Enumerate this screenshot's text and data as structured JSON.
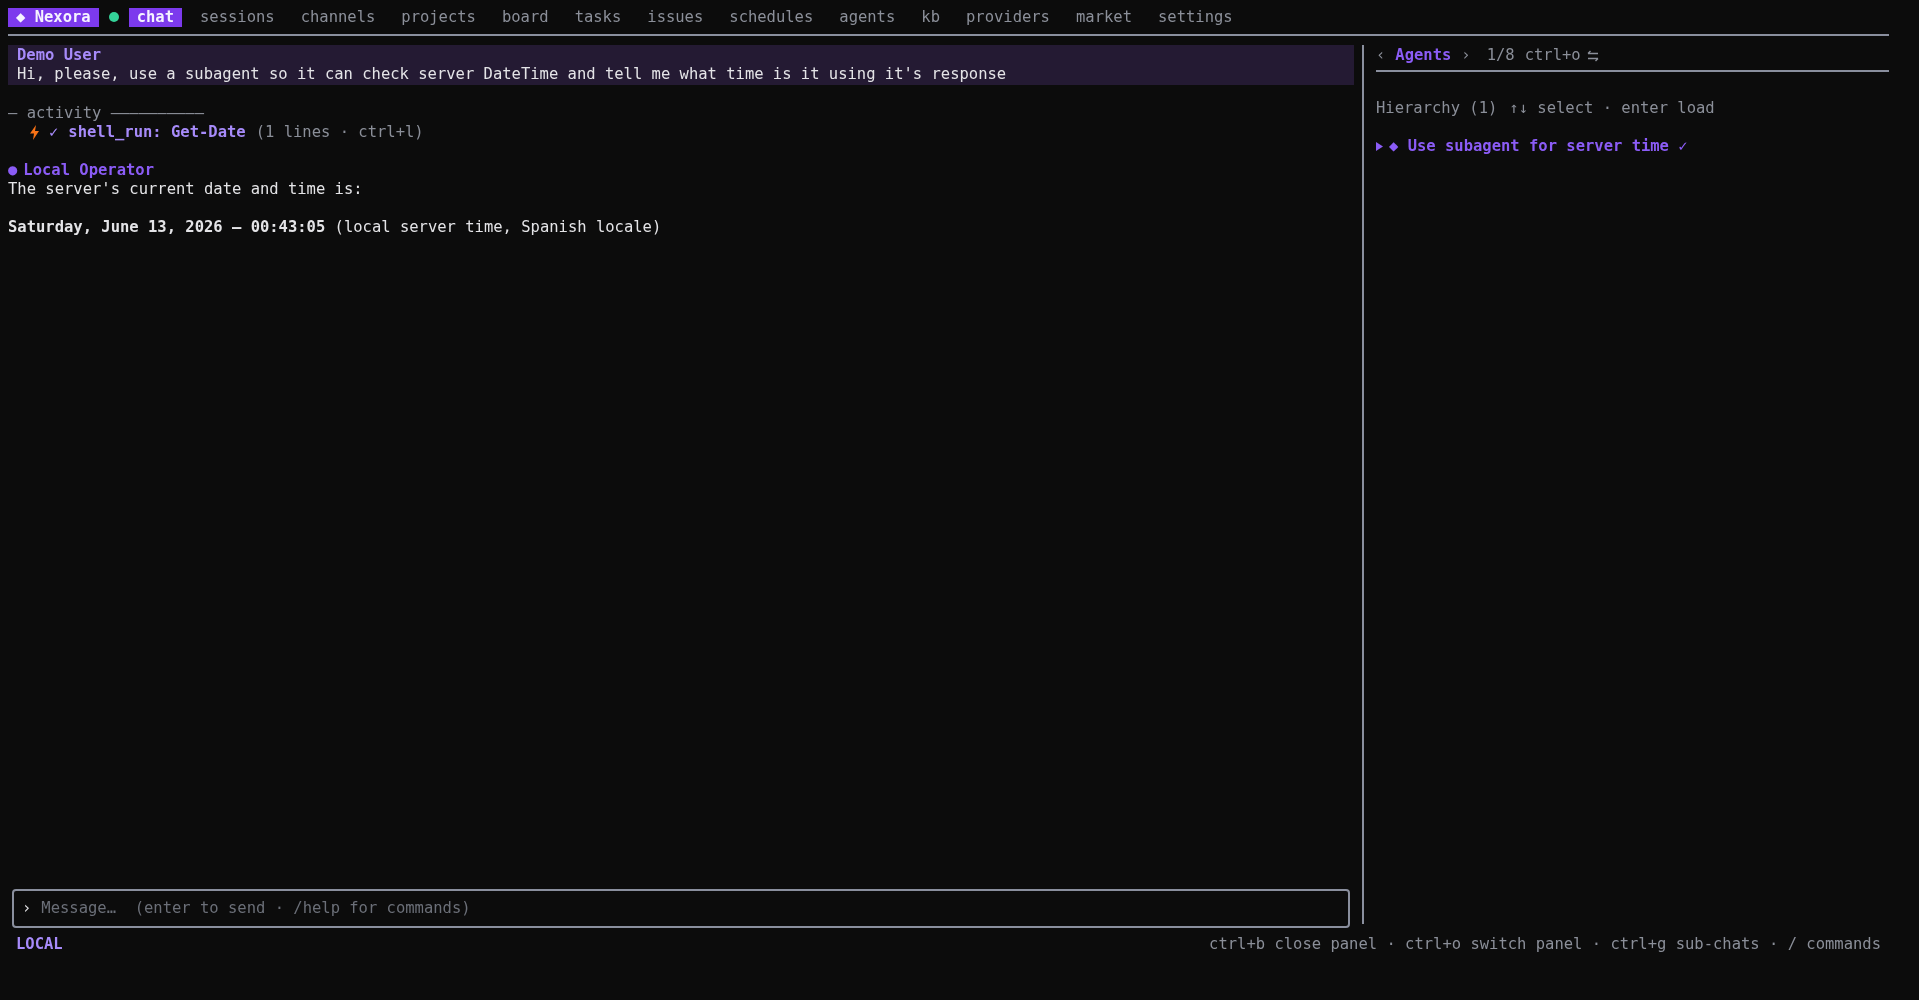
{
  "top_bar": {
    "brand": "◆ Nexora",
    "tabs": [
      {
        "label": "chat",
        "selected": true
      },
      {
        "label": "sessions",
        "selected": false
      },
      {
        "label": "channels",
        "selected": false
      },
      {
        "label": "projects",
        "selected": false
      },
      {
        "label": "board",
        "selected": false
      },
      {
        "label": "tasks",
        "selected": false
      },
      {
        "label": "issues",
        "selected": false
      },
      {
        "label": "schedules",
        "selected": false
      },
      {
        "label": "agents",
        "selected": false
      },
      {
        "label": "kb",
        "selected": false
      },
      {
        "label": "providers",
        "selected": false
      },
      {
        "label": "market",
        "selected": false
      },
      {
        "label": "settings",
        "selected": false
      }
    ]
  },
  "chat": {
    "user_message": {
      "author": "Demo User",
      "text": "Hi, please, use a subagent so it can check server DateTime and tell me what time is it using it's response"
    },
    "activity": {
      "heading": "— activity ——————————",
      "items": [
        {
          "check": "✓",
          "tool": "shell_run: Get-Date",
          "detail": "(1 lines · ctrl+l)"
        }
      ]
    },
    "reply": {
      "bullet": "●",
      "author": "Local Operator",
      "paragraphs": [
        "The server's current date and time is:",
        "**Saturday, June 13, 2026 — 00:43:05** (local server time, Spanish locale)"
      ]
    },
    "input": {
      "prompt": "›",
      "placeholder": "Message…  (enter to send · /help for commands)"
    }
  },
  "side_panel": {
    "prev": "‹",
    "title": "Agents",
    "next": "›",
    "page": "1/8",
    "shortcut": "ctrl+o",
    "hierarchy": "Hierarchy (1)",
    "hint": "↑↓ select · enter load",
    "tree": [
      {
        "label": "◆ Use subagent for server time ✓",
        "expanded": false,
        "selected": true
      }
    ]
  },
  "status_bar": {
    "mode": "LOCAL",
    "hints": "ctrl+b close panel · ctrl+o switch panel · ctrl+g sub-chats · / commands"
  }
}
